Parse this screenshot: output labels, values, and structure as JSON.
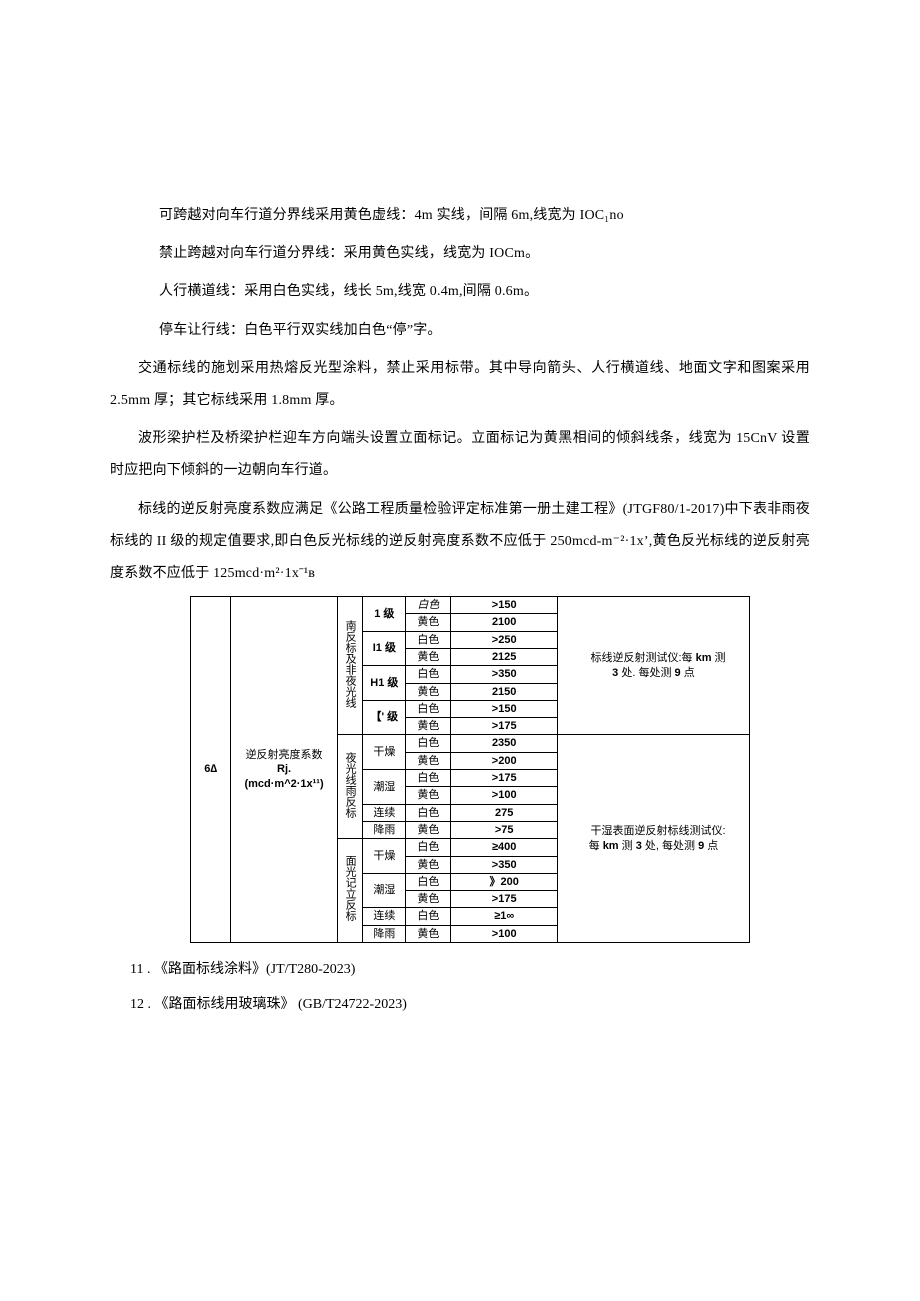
{
  "paragraphs": {
    "p1": "可跨越对向车行道分界线采用黄色虚线：4m 实线，间隔 6m,线宽为 IOC₁no",
    "p2": "禁止跨越对向车行道分界线：采用黄色实线，线宽为 IOCm。",
    "p3": "人行横道线：采用白色实线，线长 5m,线宽 0.4m,间隔 0.6m。",
    "p4": "停车让行线：白色平行双实线加白色“停”字。",
    "p5": "交通标线的施划采用热熔反光型涂料，禁止采用标带。其中导向箭头、人行横道线、地面文字和图案采用 2.5mm 厚；其它标线采用 1.8mm 厚。",
    "p6": "波形梁护栏及桥梁护栏迎车方向端头设置立面标记。立面标记为黄黑相间的倾斜线条，线宽为 15CnV 设置时应把向下倾斜的一边朝向车行道。",
    "p7": "标线的逆反射亮度系数应满足《公路工程质量检验评定标准第一册土建工程》(JTGF80/1-2017)中下表非雨夜标线的 II 级的规定值要求,即白色反光标线的逆反射亮度系数不应低于 250mcd-m⁻²·1x’,黄色反光标线的逆反射亮度系数不应低于 125mcd·m²·1xˉ¹ʙ"
  },
  "table": {
    "rowLabel": "6∆",
    "param": {
      "l1": "逆反射亮度系数",
      "l2": "Rj.",
      "l3": "(mcd·m^2·1x¹¹)"
    },
    "group1": {
      "title": "南反标及非夜光线",
      "levels": [
        {
          "lv": "1 级",
          "rows": [
            {
              "c": "白色",
              "v": ">150"
            },
            {
              "c": "黄色",
              "v": "2100"
            }
          ]
        },
        {
          "lv": "I1 级",
          "rows": [
            {
              "c": "白色",
              "v": ">250"
            },
            {
              "c": "黄色",
              "v": "2125"
            }
          ]
        },
        {
          "lv": "H1 级",
          "rows": [
            {
              "c": "白色",
              "v": ">350"
            },
            {
              "c": "黄色",
              "v": "2150"
            }
          ]
        },
        {
          "lv": "【' 级",
          "rows": [
            {
              "c": "白色",
              "v": ">150"
            },
            {
              "c": "黄色",
              "v": ">175"
            }
          ]
        }
      ],
      "note": "标线逆反射测试仪:每 km 测 3 处. 每处测 9 点"
    },
    "group2": {
      "title": "夜光线雨反标",
      "rows": [
        {
          "cond": "干燥",
          "c": "白色",
          "v": "2350"
        },
        {
          "cond": "",
          "c": "黄色",
          "v": ">200"
        },
        {
          "cond": "潮湿",
          "c": "白色",
          "v": ">175"
        },
        {
          "cond": "",
          "c": "黄色",
          "v": ">100"
        },
        {
          "cond": "连续",
          "c": "白色",
          "v": "275"
        },
        {
          "cond": "降雨",
          "c": "黄色",
          "v": ">75"
        }
      ]
    },
    "group3": {
      "title": "面光记立反标",
      "rows": [
        {
          "cond": "干燥",
          "c": "白色",
          "v": "≥400"
        },
        {
          "cond": "",
          "c": "黄色",
          "v": ">350"
        },
        {
          "cond": "潮湿",
          "c": "白色",
          "v": "》200"
        },
        {
          "cond": "",
          "c": "黄色",
          "v": ">175"
        },
        {
          "cond": "连续",
          "c": "白色",
          "v": "≥1∞"
        },
        {
          "cond": "降雨",
          "c": "黄色",
          "v": ">100"
        }
      ]
    },
    "note2": "干湿表面逆反射标线测试仪: 每 km 测 3 处, 每处测 9 点"
  },
  "refs": {
    "r1": "11  . 《路面标线涂料》(JT/T280-2023)",
    "r2": "12  . 《路面标线用玻璃珠》 (GB/T24722-2023)"
  }
}
